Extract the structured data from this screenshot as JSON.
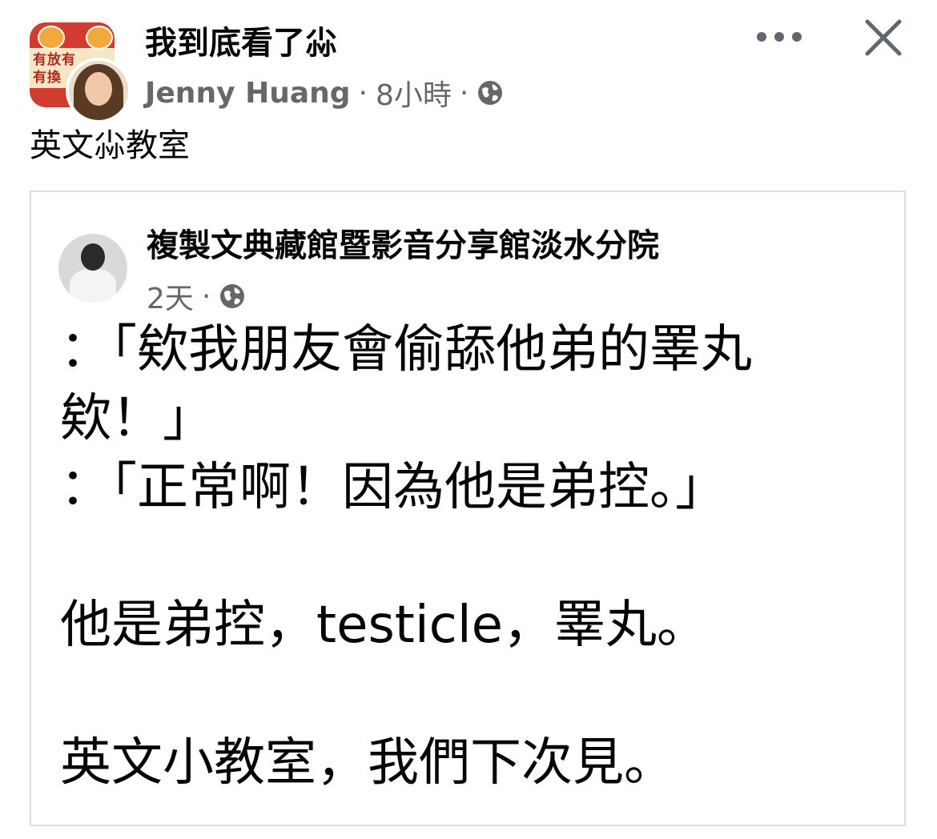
{
  "post": {
    "group_name": "我到底看了尛",
    "author": "Jenny Huang",
    "separator": "·",
    "time": "8小時",
    "privacy_icon": "globe-icon",
    "caption": "英文尛教室",
    "more_icon": "more-horizontal-icon",
    "close_icon": "close-icon",
    "group_avatar_text": "有放有\n有換"
  },
  "shared": {
    "page_name": "複製文典藏館暨影音分享館淡水分院",
    "time": "2天",
    "separator": "·",
    "privacy_icon": "globe-icon",
    "lines": [
      "：「欸我朋友會偷舔他弟的睪丸",
      "欸！」",
      "：「正常啊！因為他是弟控。」",
      "",
      "他是弟控，testicle，睪丸。",
      "",
      "英文小教室，我們下次見。"
    ]
  },
  "colors": {
    "text": "#050505",
    "secondary_text": "#65676b",
    "card_border": "#dcdde0",
    "background": "#ffffff"
  }
}
